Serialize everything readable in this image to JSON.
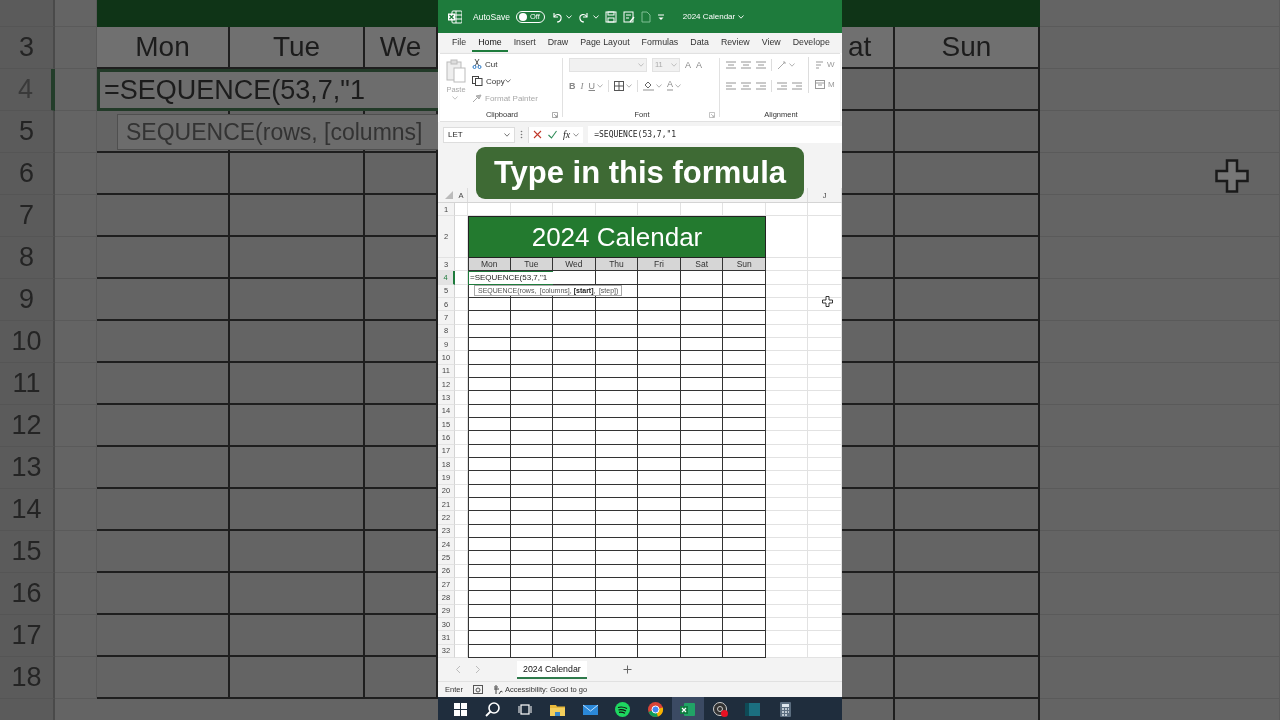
{
  "backdrop_left": {
    "row_numbers": [
      "3",
      "4",
      "5",
      "6",
      "7",
      "8",
      "9",
      "10",
      "11",
      "12",
      "13",
      "14",
      "15",
      "16",
      "17",
      "18"
    ],
    "day_headers": [
      "Mon",
      "Tue",
      "We"
    ],
    "editing_text": "=SEQUENCE(53,7,\"1",
    "tooltip": "SEQUENCE(rows, [columns]"
  },
  "backdrop_right": {
    "day_headers": [
      "at",
      "Sun"
    ]
  },
  "title_bar": {
    "autosave_label": "AutoSave",
    "autosave": {
      "on": false,
      "label": "Off"
    },
    "document_title": "2024 Calendar"
  },
  "menu_tabs": [
    {
      "label": "File",
      "selected": false
    },
    {
      "label": "Home",
      "selected": true
    },
    {
      "label": "Insert",
      "selected": false
    },
    {
      "label": "Draw",
      "selected": false
    },
    {
      "label": "Page Layout",
      "selected": false
    },
    {
      "label": "Formulas",
      "selected": false
    },
    {
      "label": "Data",
      "selected": false
    },
    {
      "label": "Review",
      "selected": false
    },
    {
      "label": "View",
      "selected": false
    },
    {
      "label": "Develope",
      "selected": false
    }
  ],
  "ribbon": {
    "clipboard": {
      "label": "Clipboard",
      "paste": {
        "label": "Paste",
        "disabled": true
      },
      "cut": {
        "label": "Cut",
        "disabled": false
      },
      "copy": {
        "label": "Copy",
        "disabled": false
      },
      "format_painter": {
        "label": "Format Painter",
        "disabled": true
      }
    },
    "font": {
      "label": "Font",
      "size": "11",
      "grow": "A",
      "shrink": "A",
      "bold": "B",
      "italic": "I",
      "underline": "U",
      "font_color": "A"
    },
    "alignment": {
      "label": "Alignment",
      "wrap": "W",
      "merge": "M"
    }
  },
  "formula_bar": {
    "name_box": "LET",
    "function_label": "fx",
    "formula": "=SEQUENCE(53,7,\"1"
  },
  "banner": {
    "text": "Type in this formula"
  },
  "sheet": {
    "column_headers": [
      "A",
      "J"
    ],
    "row_numbers": [
      "1",
      "2",
      "3",
      "4",
      "5",
      "6",
      "7",
      "8",
      "9",
      "10",
      "11",
      "12",
      "13",
      "14",
      "15",
      "16",
      "17",
      "18",
      "19",
      "20",
      "21",
      "22",
      "23",
      "24",
      "25",
      "26",
      "27",
      "28",
      "29",
      "30",
      "31",
      "32"
    ],
    "calendar": {
      "title": "2024 Calendar",
      "days": [
        "Mon",
        "Tue",
        "Wed",
        "Thu",
        "Fri",
        "Sat",
        "Sun"
      ],
      "editing_cell": "=SEQUENCE(53,7,\"1",
      "tooltip": "SEQUENCE(rows, [columns], **[start]**, [step])"
    }
  },
  "sheet_tabs": [
    {
      "label": "2024 Calendar",
      "selected": true
    }
  ],
  "status_bar": {
    "mode": "Enter",
    "accessibility": "Accessibility: Good to go"
  },
  "taskbar": [
    {
      "kind": "windows",
      "active": false
    },
    {
      "kind": "search",
      "active": false
    },
    {
      "kind": "taskview",
      "active": false
    },
    {
      "kind": "folder",
      "active": false
    },
    {
      "kind": "mail",
      "active": false
    },
    {
      "kind": "music",
      "active": false
    },
    {
      "kind": "browser",
      "active": false
    },
    {
      "kind": "excel",
      "active": true
    },
    {
      "kind": "record",
      "active": false
    },
    {
      "kind": "panel",
      "active": false
    },
    {
      "kind": "calculator",
      "active": false
    }
  ]
}
